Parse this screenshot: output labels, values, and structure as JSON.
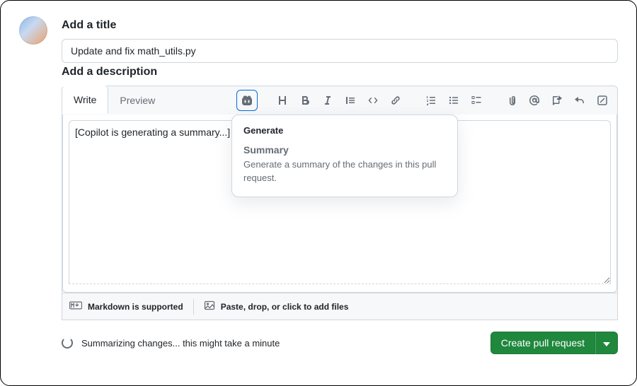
{
  "labels": {
    "add_title": "Add a title",
    "add_description": "Add a description"
  },
  "title_input": {
    "value": "Update and fix math_utils.py"
  },
  "tabs": {
    "write": "Write",
    "preview": "Preview"
  },
  "description": {
    "value": "[Copilot is generating a summary...]"
  },
  "popover": {
    "header": "Generate",
    "item_title": "Summary",
    "item_desc": "Generate a summary of the changes in this pull request."
  },
  "footer": {
    "markdown": "Markdown is supported",
    "attach": "Paste, drop, or click to add files"
  },
  "status": {
    "text": "Summarizing changes... this might take a minute"
  },
  "actions": {
    "create_pr": "Create pull request"
  }
}
